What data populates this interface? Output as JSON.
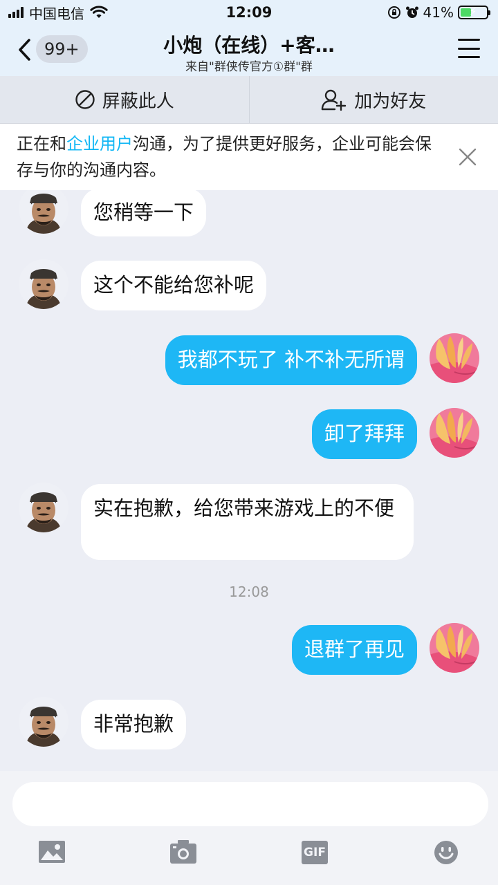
{
  "status_bar": {
    "carrier": "中国电信",
    "time": "12:09",
    "battery_pct": "41%",
    "battery_level": 0.41,
    "icons": [
      "signal-icon",
      "wifi-icon",
      "orientation-lock-icon",
      "alarm-icon",
      "battery-icon"
    ]
  },
  "header": {
    "back_count": "99+",
    "title": "小炮（在线）+客…",
    "subtitle": "来自\"群侠传官方①群\"群"
  },
  "actions": {
    "block_label": "屏蔽此人",
    "add_friend_label": "加为好友"
  },
  "notice": {
    "prefix": "正在和",
    "highlight": "企业用户",
    "suffix": "沟通，为了提供更好服务，企业可能会保存与你的沟通内容。"
  },
  "messages": [
    {
      "side": "in",
      "text": "您稍等一下"
    },
    {
      "side": "in",
      "text": "这个不能给您补呢"
    },
    {
      "side": "out",
      "text": "我都不玩了 补不补无所谓"
    },
    {
      "side": "out",
      "text": "卸了拜拜"
    },
    {
      "side": "in",
      "text": "实在抱歉，给您带来游戏上的不便"
    },
    {
      "side": "time",
      "text": "12:08"
    },
    {
      "side": "out",
      "text": "退群了再见"
    },
    {
      "side": "in",
      "text": "非常抱歉"
    }
  ],
  "input": {
    "value": ""
  },
  "toolbar": {
    "gif_label": "GIF",
    "icons": [
      "image-icon",
      "camera-icon",
      "gif-icon",
      "emoji-icon"
    ]
  },
  "colors": {
    "accent": "#12b7f5",
    "out_bubble": "#1eb7f5",
    "background": "#eceef5"
  }
}
